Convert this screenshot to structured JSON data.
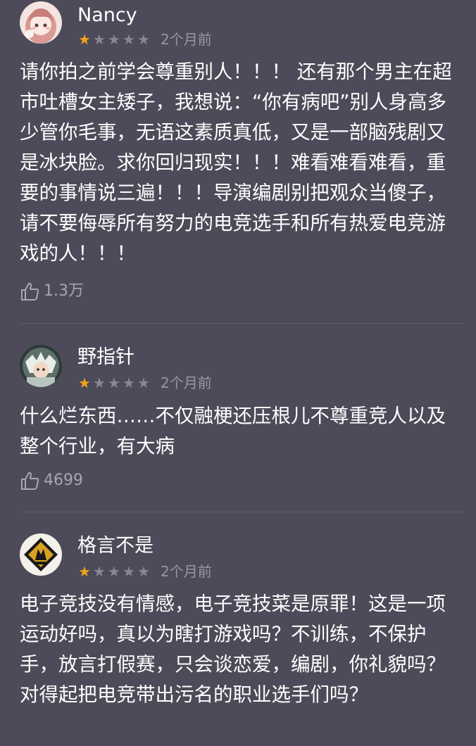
{
  "reviews": [
    {
      "username": "Nancy",
      "rating": 1,
      "max_rating": 5,
      "time": "2个月前",
      "text": "请你拍之前学会尊重别人！！！ 还有那个男主在超市吐槽女主矮子，我想说：“你有病吧”别人身高多少管你毛事，无语这素质真低，又是一部脑残剧又是冰块脸。求你回归现实！！！难看难看难看，重要的事情说三遍！！！导演编剧别把观众当傻子，请不要侮辱所有努力的电竞选手和所有热爱电竞游戏的人！！！",
      "likes": "1.3万",
      "avatar_icon": "anime-girl-avatar-icon"
    },
    {
      "username": "野指针",
      "rating": 1,
      "max_rating": 5,
      "time": "2个月前",
      "text": "什么烂东西……不仅融梗还压根儿不尊重竞人以及整个行业，有大病",
      "likes": "4699",
      "avatar_icon": "anime-character-avatar-icon"
    },
    {
      "username": "格言不是",
      "rating": 1,
      "max_rating": 5,
      "time": "2个月前",
      "text": "电子竞技没有情感，电子竞技菜是原罪！这是一项运动好吗，真以为瞎打游戏吗？不训练，不保护手，放言打假赛，只会谈恋爱，编剧，你礼貌吗？对得起把电竞带出污名的职业选手们吗？",
      "avatar_icon": "team-logo-avatar-icon"
    }
  ],
  "colors": {
    "background": "#4d4a59",
    "star_active": "#f2a31b",
    "star_inactive": "#8a8794",
    "meta_text": "#9a97a4"
  },
  "icons": {
    "like": "thumbs-up-icon",
    "star": "star-icon"
  }
}
